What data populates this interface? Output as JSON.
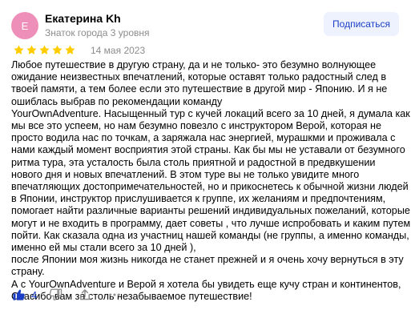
{
  "review": {
    "author": {
      "avatar_letter": "Е",
      "avatar_color": "#ee8fba",
      "name": "Екатерина Kh",
      "level": "Знаток города 3 уровня"
    },
    "subscribe_label": "Подписаться",
    "rating": 5,
    "rating_max": 5,
    "star_color": "#ffcc00",
    "date": "14 мая 2023",
    "text_lines": [
      "Любое путешествие в другую страну, да и не только- это безумно волнующее",
      "ожидание неизвестных впечатлений, которые оставят только радостный след в",
      "твоей памяти, а тем более если это путешествие в другой мир - Японию. И я не",
      "ошиблась выбрав по рекомендации команду",
      "YourOwnAdventure. Насыщенный тур с кучей локаций всего за 10 дней, я думала как",
      "мы все это успеем, но нам безумно повезло с инструктором Верой, которая не",
      "просто водила нас по точкам, а заряжала нас энергией, мурашкми и проживала с",
      "нами каждый момент восприятия этой страны. Как бы мы не уставали от безумного",
      "ритма тура, эта усталость была столь приятной и радостной в предвкушении",
      "нового дня и новых впечатлений. В этом туре вы не только увидите много",
      "впечатляющих достопримечательностей, но и прикоснетесь к обычной жизни людей",
      "в Японии, инструктор прислушивается к группе, их желаниям и предпочтениям,",
      "помогает найти различные варианты решений индивидуальных пожеланий, которые",
      "могут и не входить в программу, дает советы , что лучше испробовать и каким путем",
      "пойти. Как сказала одна из участниц нашей команды (не группы, а именно команды,",
      "именно ей мы стали всего за 10 дней ),",
      "после Японии моя жизнь никогда не станет прежней и я очень хочу вернуться в эту",
      "страну.",
      "А с YourOwnAdventure и Верой я хотела бы увидеть еще кучу стран и континентов,",
      "Спасибо вам за столь незабываемое путешествие!"
    ],
    "likes_count": "4",
    "accent_color": "#1b3fc4",
    "icons": [
      "thumbs-up-icon",
      "thumbs-down-icon",
      "share-icon",
      "more-icon"
    ]
  }
}
